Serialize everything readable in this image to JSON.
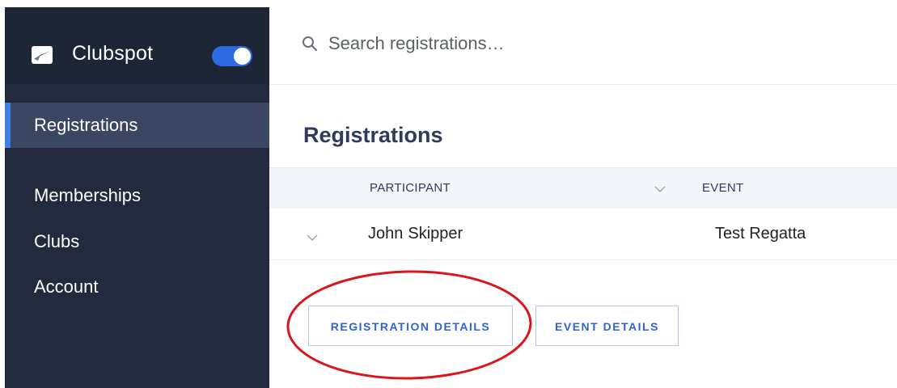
{
  "sidebar": {
    "brand": "Clubspot",
    "logo_icon": "paper-plane-icon",
    "toggle_on": true,
    "items": [
      {
        "label": "Registrations",
        "active": true
      },
      {
        "label": "Memberships",
        "active": false
      },
      {
        "label": "Clubs",
        "active": false
      },
      {
        "label": "Account",
        "active": false
      }
    ]
  },
  "search": {
    "placeholder": "Search registrations…",
    "icon": "search-icon"
  },
  "main": {
    "title": "Registrations",
    "table": {
      "headers": [
        "PARTICIPANT",
        "EVENT"
      ],
      "rows": [
        {
          "first_name": "John",
          "last_name": "Skipper",
          "event": "Test Regatta"
        }
      ]
    },
    "buttons": {
      "registration_details": "REGISTRATION DETAILS",
      "event_details": "EVENT DETAILS"
    }
  },
  "colors": {
    "sidebar_bg": "#232a3d",
    "active_item_bg": "#3b4662",
    "accent": "#3f7fe8",
    "button_text": "#2f63d4",
    "annotation": "#d9161c"
  }
}
